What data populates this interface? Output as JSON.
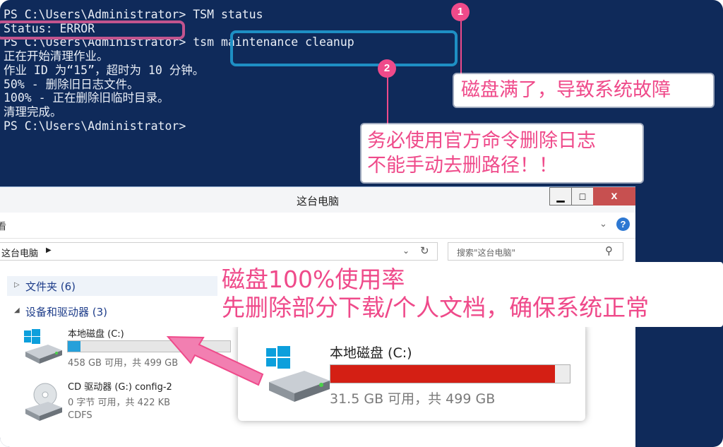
{
  "console": {
    "lines": [
      "PS C:\\Users\\Administrator> TSM status",
      "Status: ERROR",
      "PS C:\\Users\\Administrator> tsm maintenance cleanup",
      "正在开始清理作业。",
      "作业 ID 为“15”，超时为 10 分钟。",
      "50% - 删除旧日志文件。",
      "100% - 正在删除旧临时目录。",
      "清理完成。",
      "PS C:\\Users\\Administrator>"
    ]
  },
  "badges": {
    "one": "1",
    "two": "2"
  },
  "callouts": {
    "one": "磁盘满了，导致系统故障",
    "two_line1": "务必使用官方命令删除日志",
    "two_line2": "不能手动去删路径！！",
    "three_line1": "磁盘100%使用率",
    "three_line2": "先删除部分下载/个人文档，确保系统正常"
  },
  "explorer": {
    "title": "这台电脑",
    "ribbon_label": "看",
    "address": "这台电脑",
    "search_placeholder": "搜索\"这台电脑\"",
    "group_folders": "文件夹 (6)",
    "group_devices": "设备和驱动器 (3)",
    "drive_c": {
      "name": "本地磁盘 (C:)",
      "info": "458 GB 可用，共 499 GB",
      "used_fraction": 0.08
    },
    "drive_cd": {
      "name": "CD 驱动器 (G:) config-2",
      "info": "0 字节 可用，共 422 KB",
      "fs": "CDFS"
    }
  },
  "zoom": {
    "name": "本地磁盘 (C:)",
    "info": "31.5 GB 可用，共 499 GB",
    "used_fraction": 0.937
  },
  "colors": {
    "accent_pink": "#ef4a8a",
    "console_bg": "#0f2a5a",
    "bar_full": "#d41f14",
    "bar_normal": "#26a0da"
  },
  "icons": {
    "os_logo": "windows-logo-icon",
    "disk": "hard-drive-icon",
    "cd": "cd-drive-icon"
  }
}
